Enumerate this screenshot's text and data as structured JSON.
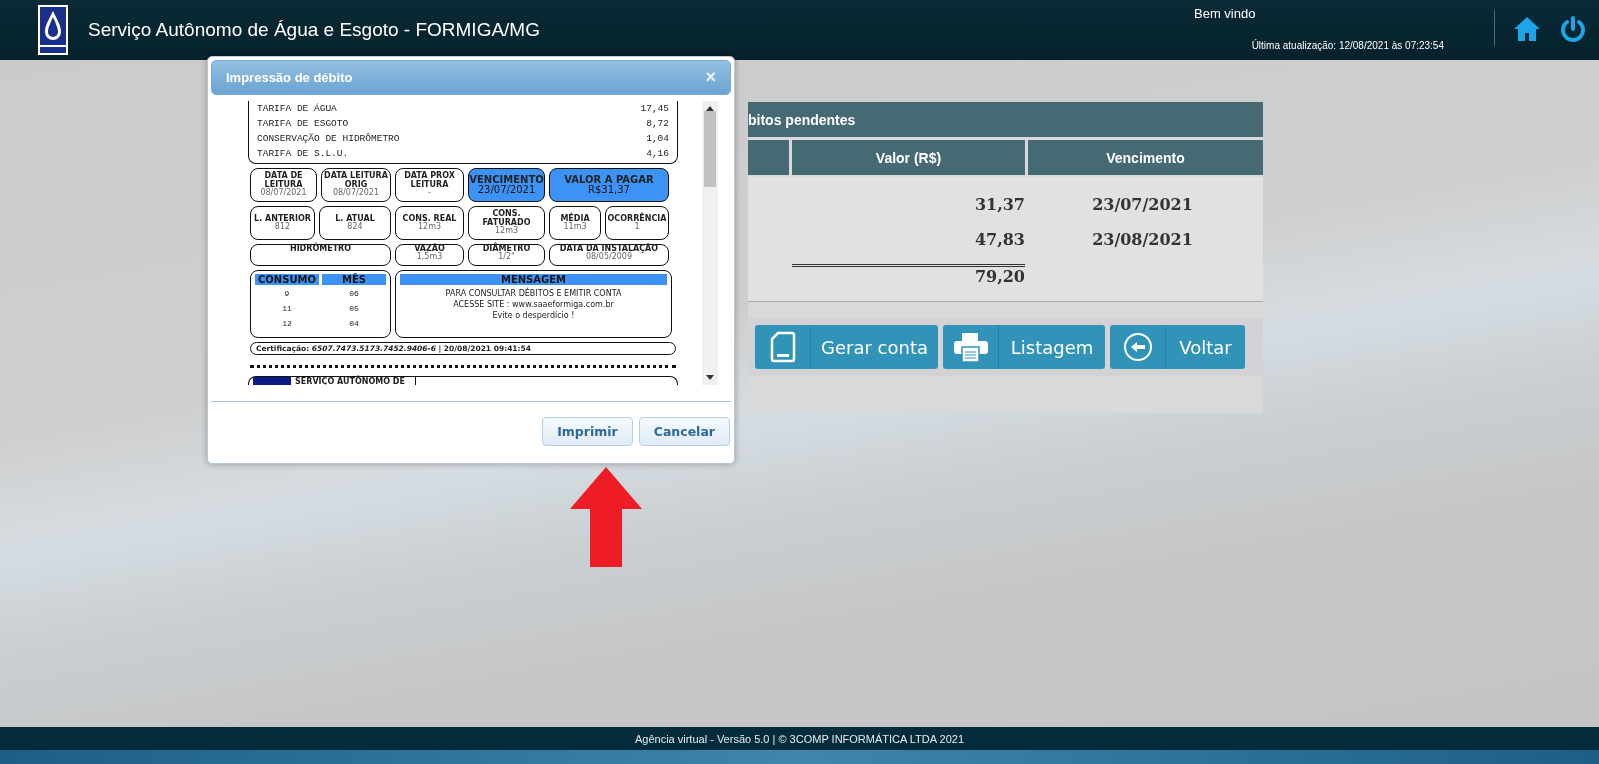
{
  "header": {
    "title": "Serviço Autônomo de Água e Esgoto - FORMIGA/MG",
    "welcome": "Bem vindo",
    "last_update": "Última atualização: 12/08/2021 às 07:23:54"
  },
  "panel": {
    "title": "bitos pendentes",
    "columns": [
      "",
      "Valor (R$)",
      "Vencimento"
    ],
    "rows": [
      {
        "value": "31,37",
        "due": "23/07/2021"
      },
      {
        "value": "47,83",
        "due": "23/08/2021"
      }
    ],
    "total": "79,20",
    "buttons": [
      {
        "kind": "document",
        "label": "Gerar conta"
      },
      {
        "kind": "printer",
        "label": "Listagem"
      },
      {
        "kind": "back",
        "label": "Voltar"
      }
    ]
  },
  "dialog": {
    "title": "Impressão de débito",
    "close": "×",
    "charges": [
      {
        "label": "TARIFA DE ÁGUA",
        "value": "17,45"
      },
      {
        "label": "TARIFA DE ESGOTO",
        "value": "8,72"
      },
      {
        "label": "CONSERVAÇÃO DE HIDRÔMETRO",
        "value": "1,04"
      },
      {
        "label": "TARIFA DE S.L.U.",
        "value": "4,16"
      }
    ],
    "field_rows": [
      [
        {
          "label": "DATA DE LEITURA",
          "value": "08/07/2021",
          "highlighted": false
        },
        {
          "label": "DATA LEITURA ORIG",
          "value": "08/07/2021",
          "highlighted": false
        },
        {
          "label": "DATA PROX LEITURA",
          "value": "-",
          "highlighted": false
        },
        {
          "label": "VENCIMENTO",
          "value": "23/07/2021",
          "highlighted": true
        },
        {
          "label": "VALOR A PAGAR",
          "value": "R$31,37",
          "highlighted": true
        }
      ],
      [
        {
          "label": "L. ANTERIOR",
          "value": "812",
          "highlighted": false
        },
        {
          "label": "L. ATUAL",
          "value": "824",
          "highlighted": false
        },
        {
          "label": "CONS. REAL",
          "value": "12m3",
          "highlighted": false
        },
        {
          "label": "CONS. FATURADO",
          "value": "12m3",
          "highlighted": false
        },
        {
          "label": "MÉDIA",
          "value": "11m3",
          "highlighted": false
        },
        {
          "label": "OCORRÊNCIA",
          "value": "1",
          "highlighted": false
        }
      ],
      [
        {
          "label": "HIDRÔMETRO",
          "highlighted": false
        },
        {
          "label": "VAZÃO",
          "value": "1,5m3",
          "highlighted": false
        },
        {
          "label": "DIÂMETRO",
          "value": "1/2\"",
          "highlighted": false
        },
        {
          "label": "DATA DA INSTALAÇÃO",
          "value": "08/05/2009",
          "highlighted": false
        }
      ]
    ],
    "consumption": {
      "columns": [
        "CONSUMO",
        "MÊS"
      ],
      "rows": [
        [
          "9",
          "06"
        ],
        [
          "11",
          "05"
        ],
        [
          "12",
          "04"
        ]
      ]
    },
    "message": {
      "title": "MENSAGEM",
      "lines": [
        "PARA CONSULTAR DÉBITOS E EMITIR CONTA",
        "ACESSE SITE : www.saaeformiga.com.br",
        "Evite o desperdício !"
      ]
    },
    "certification": "Certificação: *6507.7473.5173.7452.9406-6* | 20/08/2021 09:41:54",
    "next_stub": "SERVIÇO AUTÔNOMO DE",
    "buttons": [
      "Imprimir",
      "Cancelar"
    ]
  },
  "footer": "Agência virtual - Versão 5.0 | © 3COMP INFORMÁTICA LTDA 2021"
}
